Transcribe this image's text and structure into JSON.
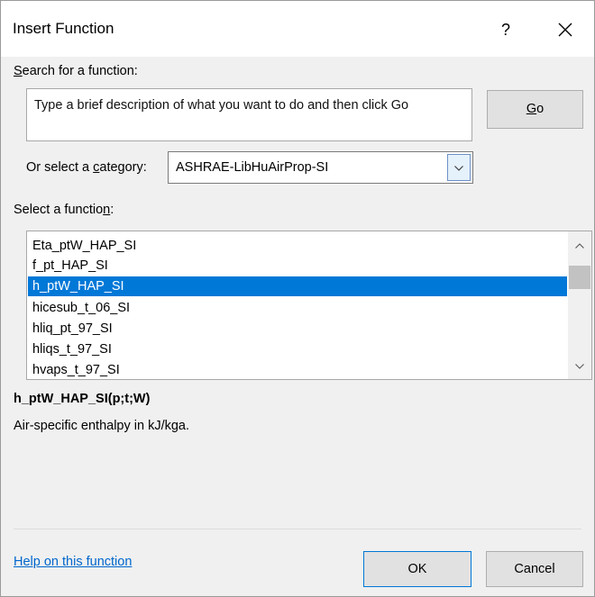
{
  "window": {
    "title": "Insert Function",
    "help_label": "?"
  },
  "search": {
    "label_prefix": "",
    "label_accel": "S",
    "label_rest": "earch for a function:",
    "placeholder": "Type a brief description of what you want to do and then click Go",
    "go_accel": "G",
    "go_rest": "o"
  },
  "category": {
    "label_prefix": "Or select a ",
    "label_accel": "c",
    "label_rest": "ategory:",
    "selected": "ASHRAE-LibHuAirProp-SI"
  },
  "functions": {
    "label_prefix": "Select a functio",
    "label_accel": "n",
    "label_rest": ":",
    "items": [
      {
        "name": "Eta_ptW_HAP_SI",
        "selected": false
      },
      {
        "name": "f_pt_HAP_SI",
        "selected": false
      },
      {
        "name": "h_ptW_HAP_SI",
        "selected": true
      },
      {
        "name": "hicesub_t_06_SI",
        "selected": false
      },
      {
        "name": "hliq_pt_97_SI",
        "selected": false
      },
      {
        "name": "hliqs_t_97_SI",
        "selected": false
      },
      {
        "name": "hvaps_t_97_SI",
        "selected": false
      }
    ]
  },
  "details": {
    "signature": "h_ptW_HAP_SI(p;t;W)",
    "description": "Air-specific enthalpy in kJ/kga."
  },
  "footer": {
    "help_link": "Help on this function",
    "ok_label": "OK",
    "cancel_label": "Cancel"
  },
  "icons": {
    "close": "close-icon",
    "dropdown": "chevron-down-icon",
    "scroll_up": "chevron-up-icon",
    "scroll_down": "chevron-down-icon"
  },
  "colors": {
    "selection": "#0078d7",
    "link": "#0066cc"
  }
}
